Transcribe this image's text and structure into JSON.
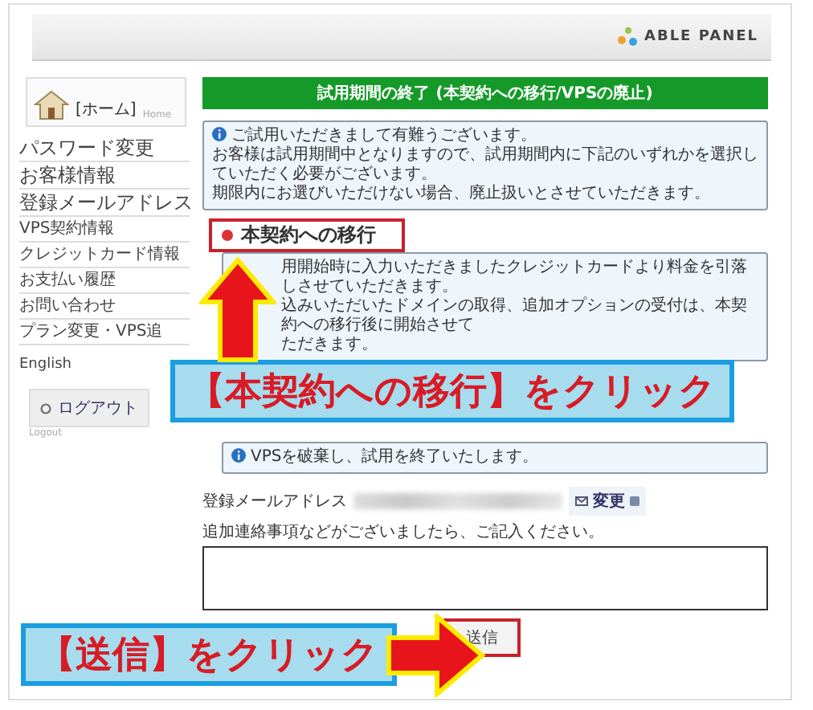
{
  "header": {
    "logo_text": "ABLE PANEL"
  },
  "sidebar": {
    "home": {
      "label": "[ホーム]",
      "sublabel": "Home"
    },
    "items": [
      {
        "label": "パスワード変更",
        "kind": "primary"
      },
      {
        "label": "お客様情報",
        "kind": "primary"
      },
      {
        "label": "登録メールアドレス",
        "kind": "primary"
      },
      {
        "label": "VPS契約情報",
        "kind": "secondary"
      },
      {
        "label": "クレジットカード情報",
        "kind": "secondary"
      },
      {
        "label": "お支払い履歴",
        "kind": "secondary"
      },
      {
        "label": "お問い合わせ",
        "kind": "secondary"
      },
      {
        "label": "プラン変更・VPS追",
        "kind": "secondary"
      }
    ],
    "language_link": "English",
    "logout": {
      "label": "ログアウト",
      "sublabel": "Logout"
    }
  },
  "main": {
    "title": "試用期間の終了 (本契約への移行/VPSの廃止)",
    "notice": [
      {
        "text": "ご試用いただきまして有難うございます。",
        "icon": true
      },
      {
        "text": "お客様は試用期間中となりますので、試用期間内に下記のいずれかを選択していただく必要がございます。",
        "icon": false
      },
      {
        "text": "期限内にお選びいただけない場合、廃止扱いとさせていただきます。",
        "icon": false
      }
    ],
    "sections": [
      {
        "heading": "本契約への移行",
        "notes": [
          "用開始時に入力いただきましたクレジットカードより料金を引落しさせていただきます。",
          "込みいただいたドメインの取得、追加オプションの受付は、本契約への移行後に開始させて",
          "ただきます。"
        ]
      },
      {
        "info_icon": true,
        "notes": [
          "VPSを破棄し、試用を終了いたします。"
        ]
      }
    ],
    "email": {
      "label": "登録メールアドレス",
      "change_button": "変更"
    },
    "comment": {
      "label": "追加連絡事項などがございましたら、ご記入ください。"
    },
    "submit": {
      "label": "送信",
      "highlighted": true
    }
  },
  "callouts": [
    {
      "text": "【本契約への移行】をクリック",
      "kind": "up"
    },
    {
      "text": "【送信】をクリック",
      "kind": "right"
    }
  ]
}
